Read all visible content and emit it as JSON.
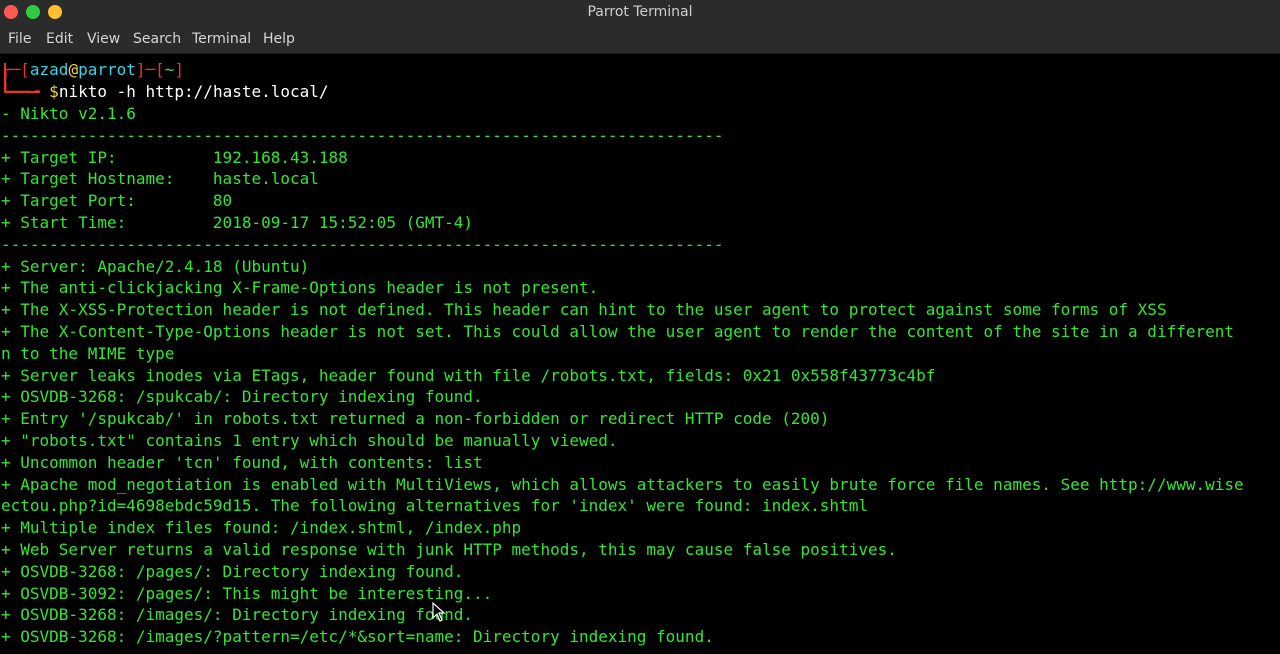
{
  "window": {
    "title": "Parrot Terminal"
  },
  "menu": {
    "file": "File",
    "edit": "Edit",
    "view": "View",
    "search": "Search",
    "terminal": "Terminal",
    "help": "Help"
  },
  "prompt": {
    "open": "┌─[",
    "user": "azad",
    "at": "@",
    "host": "parrot",
    "sep": "]─[",
    "dir": "~",
    "close": "]",
    "arrow": "└──╼ ",
    "dollar": "$",
    "command": "nikto -h http://haste.local/"
  },
  "output": [
    "- Nikto v2.1.6",
    "---------------------------------------------------------------------------",
    "+ Target IP:          192.168.43.188",
    "+ Target Hostname:    haste.local",
    "+ Target Port:        80",
    "+ Start Time:         2018-09-17 15:52:05 (GMT-4)",
    "---------------------------------------------------------------------------",
    "+ Server: Apache/2.4.18 (Ubuntu)",
    "+ The anti-clickjacking X-Frame-Options header is not present.",
    "+ The X-XSS-Protection header is not defined. This header can hint to the user agent to protect against some forms of XSS",
    "+ The X-Content-Type-Options header is not set. This could allow the user agent to render the content of the site in a different",
    "n to the MIME type",
    "+ Server leaks inodes via ETags, header found with file /robots.txt, fields: 0x21 0x558f43773c4bf",
    "+ OSVDB-3268: /spukcab/: Directory indexing found.",
    "+ Entry '/spukcab/' in robots.txt returned a non-forbidden or redirect HTTP code (200)",
    "+ \"robots.txt\" contains 1 entry which should be manually viewed.",
    "+ Uncommon header 'tcn' found, with contents: list",
    "+ Apache mod_negotiation is enabled with MultiViews, which allows attackers to easily brute force file names. See http://www.wise",
    "ectou.php?id=4698ebdc59d15. The following alternatives for 'index' were found: index.shtml",
    "+ Multiple index files found: /index.shtml, /index.php",
    "+ Web Server returns a valid response with junk HTTP methods, this may cause false positives.",
    "+ OSVDB-3268: /pages/: Directory indexing found.",
    "+ OSVDB-3092: /pages/: This might be interesting...",
    "+ OSVDB-3268: /images/: Directory indexing found.",
    "+ OSVDB-3268: /images/?pattern=/etc/*&sort=name: Directory indexing found."
  ],
  "colors": {
    "output": "#33e633",
    "prompt_frame": "#e8342e",
    "user": "#3ad4e8",
    "host": "#3ad4e8",
    "dollar": "#f2d335",
    "command": "#ffffff"
  }
}
